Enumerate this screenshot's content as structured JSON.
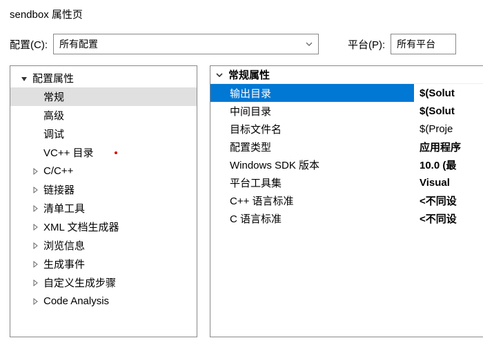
{
  "window": {
    "title": "sendbox 属性页"
  },
  "toolbar": {
    "config_label": "配置(C):",
    "config_value": "所有配置",
    "platform_label": "平台(P):",
    "platform_value": "所有平台"
  },
  "tree": {
    "root_label": "配置属性",
    "items": [
      {
        "label": "常规",
        "expandable": false,
        "selected": true
      },
      {
        "label": "高级",
        "expandable": false,
        "selected": false
      },
      {
        "label": "调试",
        "expandable": false,
        "selected": false
      },
      {
        "label": "VC++ 目录",
        "expandable": false,
        "selected": false,
        "marker": true
      },
      {
        "label": "C/C++",
        "expandable": true,
        "selected": false
      },
      {
        "label": "链接器",
        "expandable": true,
        "selected": false
      },
      {
        "label": "清单工具",
        "expandable": true,
        "selected": false
      },
      {
        "label": "XML 文档生成器",
        "expandable": true,
        "selected": false
      },
      {
        "label": "浏览信息",
        "expandable": true,
        "selected": false
      },
      {
        "label": "生成事件",
        "expandable": true,
        "selected": false
      },
      {
        "label": "自定义生成步骤",
        "expandable": true,
        "selected": false
      },
      {
        "label": "Code Analysis",
        "expandable": true,
        "selected": false
      }
    ]
  },
  "props": {
    "group_label": "常规属性",
    "rows": [
      {
        "label": "输出目录",
        "value": "$(Solut",
        "bold": true,
        "selected": true
      },
      {
        "label": "中间目录",
        "value": "$(Solut",
        "bold": true,
        "selected": false
      },
      {
        "label": "目标文件名",
        "value": "$(Proje",
        "bold": false,
        "selected": false
      },
      {
        "label": "配置类型",
        "value": "应用程序",
        "bold": true,
        "selected": false
      },
      {
        "label": "Windows SDK 版本",
        "value": "10.0 (最",
        "bold": true,
        "selected": false
      },
      {
        "label": "平台工具集",
        "value": "Visual ",
        "bold": true,
        "selected": false
      },
      {
        "label": "C++ 语言标准",
        "value": "<不同设",
        "bold": true,
        "selected": false
      },
      {
        "label": "C 语言标准",
        "value": "<不同设",
        "bold": true,
        "selected": false
      }
    ]
  }
}
